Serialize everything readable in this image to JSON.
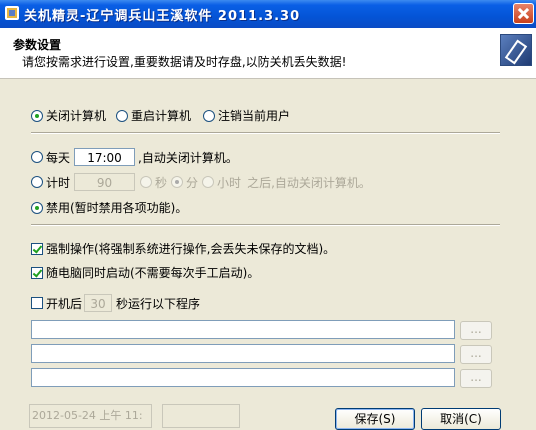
{
  "window": {
    "title": "关机精灵-辽宁调兵山王溪软件 2011.3.30"
  },
  "header": {
    "title": "参数设置",
    "subtitle": "请您按需求进行设置,重要数据请及时存盘,以防关机丢失数据!"
  },
  "action_options": [
    {
      "label": "关闭计算机",
      "selected": true
    },
    {
      "label": "重启计算机",
      "selected": false
    },
    {
      "label": "注销当前用户",
      "selected": false
    }
  ],
  "schedule": {
    "daily": {
      "label": "每天",
      "time": "17:00",
      "suffix": ",自动关闭计算机。",
      "selected": false
    },
    "timer": {
      "label": "计时",
      "value": "90",
      "units": [
        {
          "label": "秒",
          "selected": false
        },
        {
          "label": "分",
          "selected": true
        },
        {
          "label": "小时",
          "selected": false
        }
      ],
      "suffix": "之后,自动关闭计算机。",
      "selected": false
    },
    "disabled": {
      "label": "禁用(暂时禁用各项功能)。",
      "selected": true
    }
  },
  "options": {
    "force": {
      "label": "强制操作(将强制系统进行操作,会丢失未保存的文档)。",
      "checked": true
    },
    "autostart": {
      "label": "随电脑同时启动(不需要每次手工启动)。",
      "checked": true
    }
  },
  "run_programs": {
    "label_before": "开机后",
    "seconds": "30",
    "label_after": "秒运行以下程序",
    "checked": false,
    "browse_label": "..."
  },
  "status": {
    "datetime": "2012-05-24 上午 11:"
  },
  "buttons": {
    "save": "保存(S)",
    "cancel": "取消(C)"
  }
}
